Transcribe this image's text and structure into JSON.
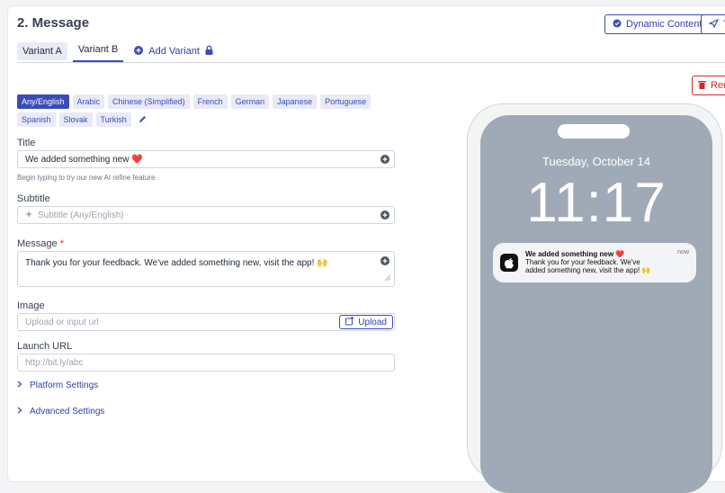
{
  "header": {
    "title": "2. Message"
  },
  "toolbar": {
    "dynamic_content": "Dynamic Content",
    "test_label": "T"
  },
  "tabs": [
    {
      "label": "Variant A"
    },
    {
      "label": "Variant B"
    }
  ],
  "add_variant": "Add Variant",
  "remove_label": "Rem",
  "languages": [
    "Any/English",
    "Arabic",
    "Chinese (Simplified)",
    "French",
    "German",
    "Japanese",
    "Portuguese",
    "Spanish",
    "Slovak",
    "Turkish"
  ],
  "form": {
    "title_label": "Title",
    "title_value": "We added something new ❤️",
    "title_hint": "Begin typing to try our new AI refine feature",
    "subtitle_label": "Subtitle",
    "subtitle_placeholder": "Subtitle (Any/English)",
    "message_label": "Message",
    "message_value": "Thank you for your feedback. We've added something new, visit the app! 🙌",
    "image_label": "Image",
    "image_placeholder": "Upload or input url",
    "upload_label": "Upload",
    "launch_label": "Launch URL",
    "launch_placeholder": "http://bit.ly/abc",
    "platform_settings": "Platform Settings",
    "advanced_settings": "Advanced Settings"
  },
  "preview": {
    "date": "Tuesday, October 14",
    "time": "11:17",
    "notif_title": "We added something new ❤️",
    "notif_body": "Thank you for your feedback. We've added something new, visit the app! 🙌",
    "notif_time": "now"
  },
  "colors": {
    "accent": "#3b4cb8",
    "danger": "#dc2626",
    "lockscreen": "#a0aab7"
  }
}
